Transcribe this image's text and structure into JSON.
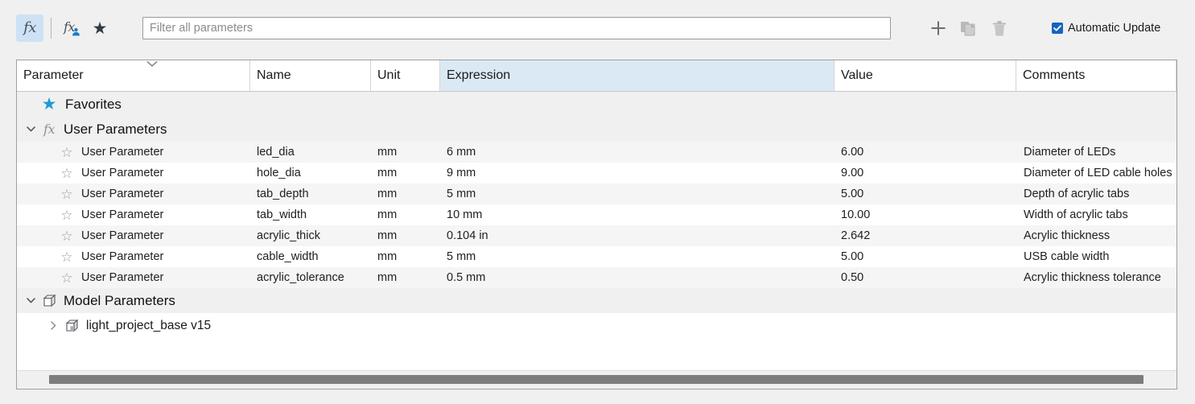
{
  "toolbar": {
    "fx_button": {
      "name": "fx-toggle",
      "glyph": "fx",
      "active": true
    },
    "fx_user_button": {
      "name": "fx-user",
      "glyph": "fx"
    },
    "favorites_button": {
      "name": "favorites",
      "glyph": "★"
    },
    "add_label": "+",
    "copy_label": "copy",
    "delete_label": "delete",
    "automatic_update_label": "Automatic Update",
    "automatic_update_checked": true,
    "checkbox_color": "#1565c0"
  },
  "search": {
    "value": "",
    "placeholder": "Filter all parameters"
  },
  "table": {
    "columns": [
      {
        "label": "Parameter",
        "highlight": false
      },
      {
        "label": "Name",
        "highlight": false
      },
      {
        "label": "Unit",
        "highlight": false
      },
      {
        "label": "Expression",
        "highlight": true
      },
      {
        "label": "Value",
        "highlight": false
      },
      {
        "label": "Comments",
        "highlight": false
      }
    ],
    "sort_indicator": "chevron-down",
    "groups": {
      "favorites": {
        "label": "Favorites",
        "icon": "star-icon",
        "selected": true
      },
      "user_parameters": {
        "label": "User Parameters",
        "icon": "fx-icon",
        "expanded": true
      },
      "model_parameters": {
        "label": "Model Parameters",
        "icon": "cube-icon",
        "expanded": true
      }
    },
    "rows": [
      {
        "parameter": "User Parameter",
        "name": "led_dia",
        "unit": "mm",
        "expression": "6 mm",
        "value": "6.00",
        "comments": "Diameter of LEDs"
      },
      {
        "parameter": "User Parameter",
        "name": "hole_dia",
        "unit": "mm",
        "expression": "9 mm",
        "value": "9.00",
        "comments": "Diameter of LED cable holes"
      },
      {
        "parameter": "User Parameter",
        "name": "tab_depth",
        "unit": "mm",
        "expression": "5 mm",
        "value": "5.00",
        "comments": "Depth of acrylic tabs"
      },
      {
        "parameter": "User Parameter",
        "name": "tab_width",
        "unit": "mm",
        "expression": "10 mm",
        "value": "10.00",
        "comments": "Width of acrylic tabs"
      },
      {
        "parameter": "User Parameter",
        "name": "acrylic_thick",
        "unit": "mm",
        "expression": "0.104 in",
        "value": "2.642",
        "comments": "Acrylic thickness"
      },
      {
        "parameter": "User Parameter",
        "name": "cable_width",
        "unit": "mm",
        "expression": "5 mm",
        "value": "5.00",
        "comments": "USB cable width"
      },
      {
        "parameter": "User Parameter",
        "name": "acrylic_tolerance",
        "unit": "mm",
        "expression": "0.5 mm",
        "value": "0.50",
        "comments": "Acrylic thickness tolerance"
      }
    ],
    "model_children": [
      {
        "label": "light_project_base v15",
        "icon": "component-icon",
        "expanded": false
      }
    ]
  }
}
